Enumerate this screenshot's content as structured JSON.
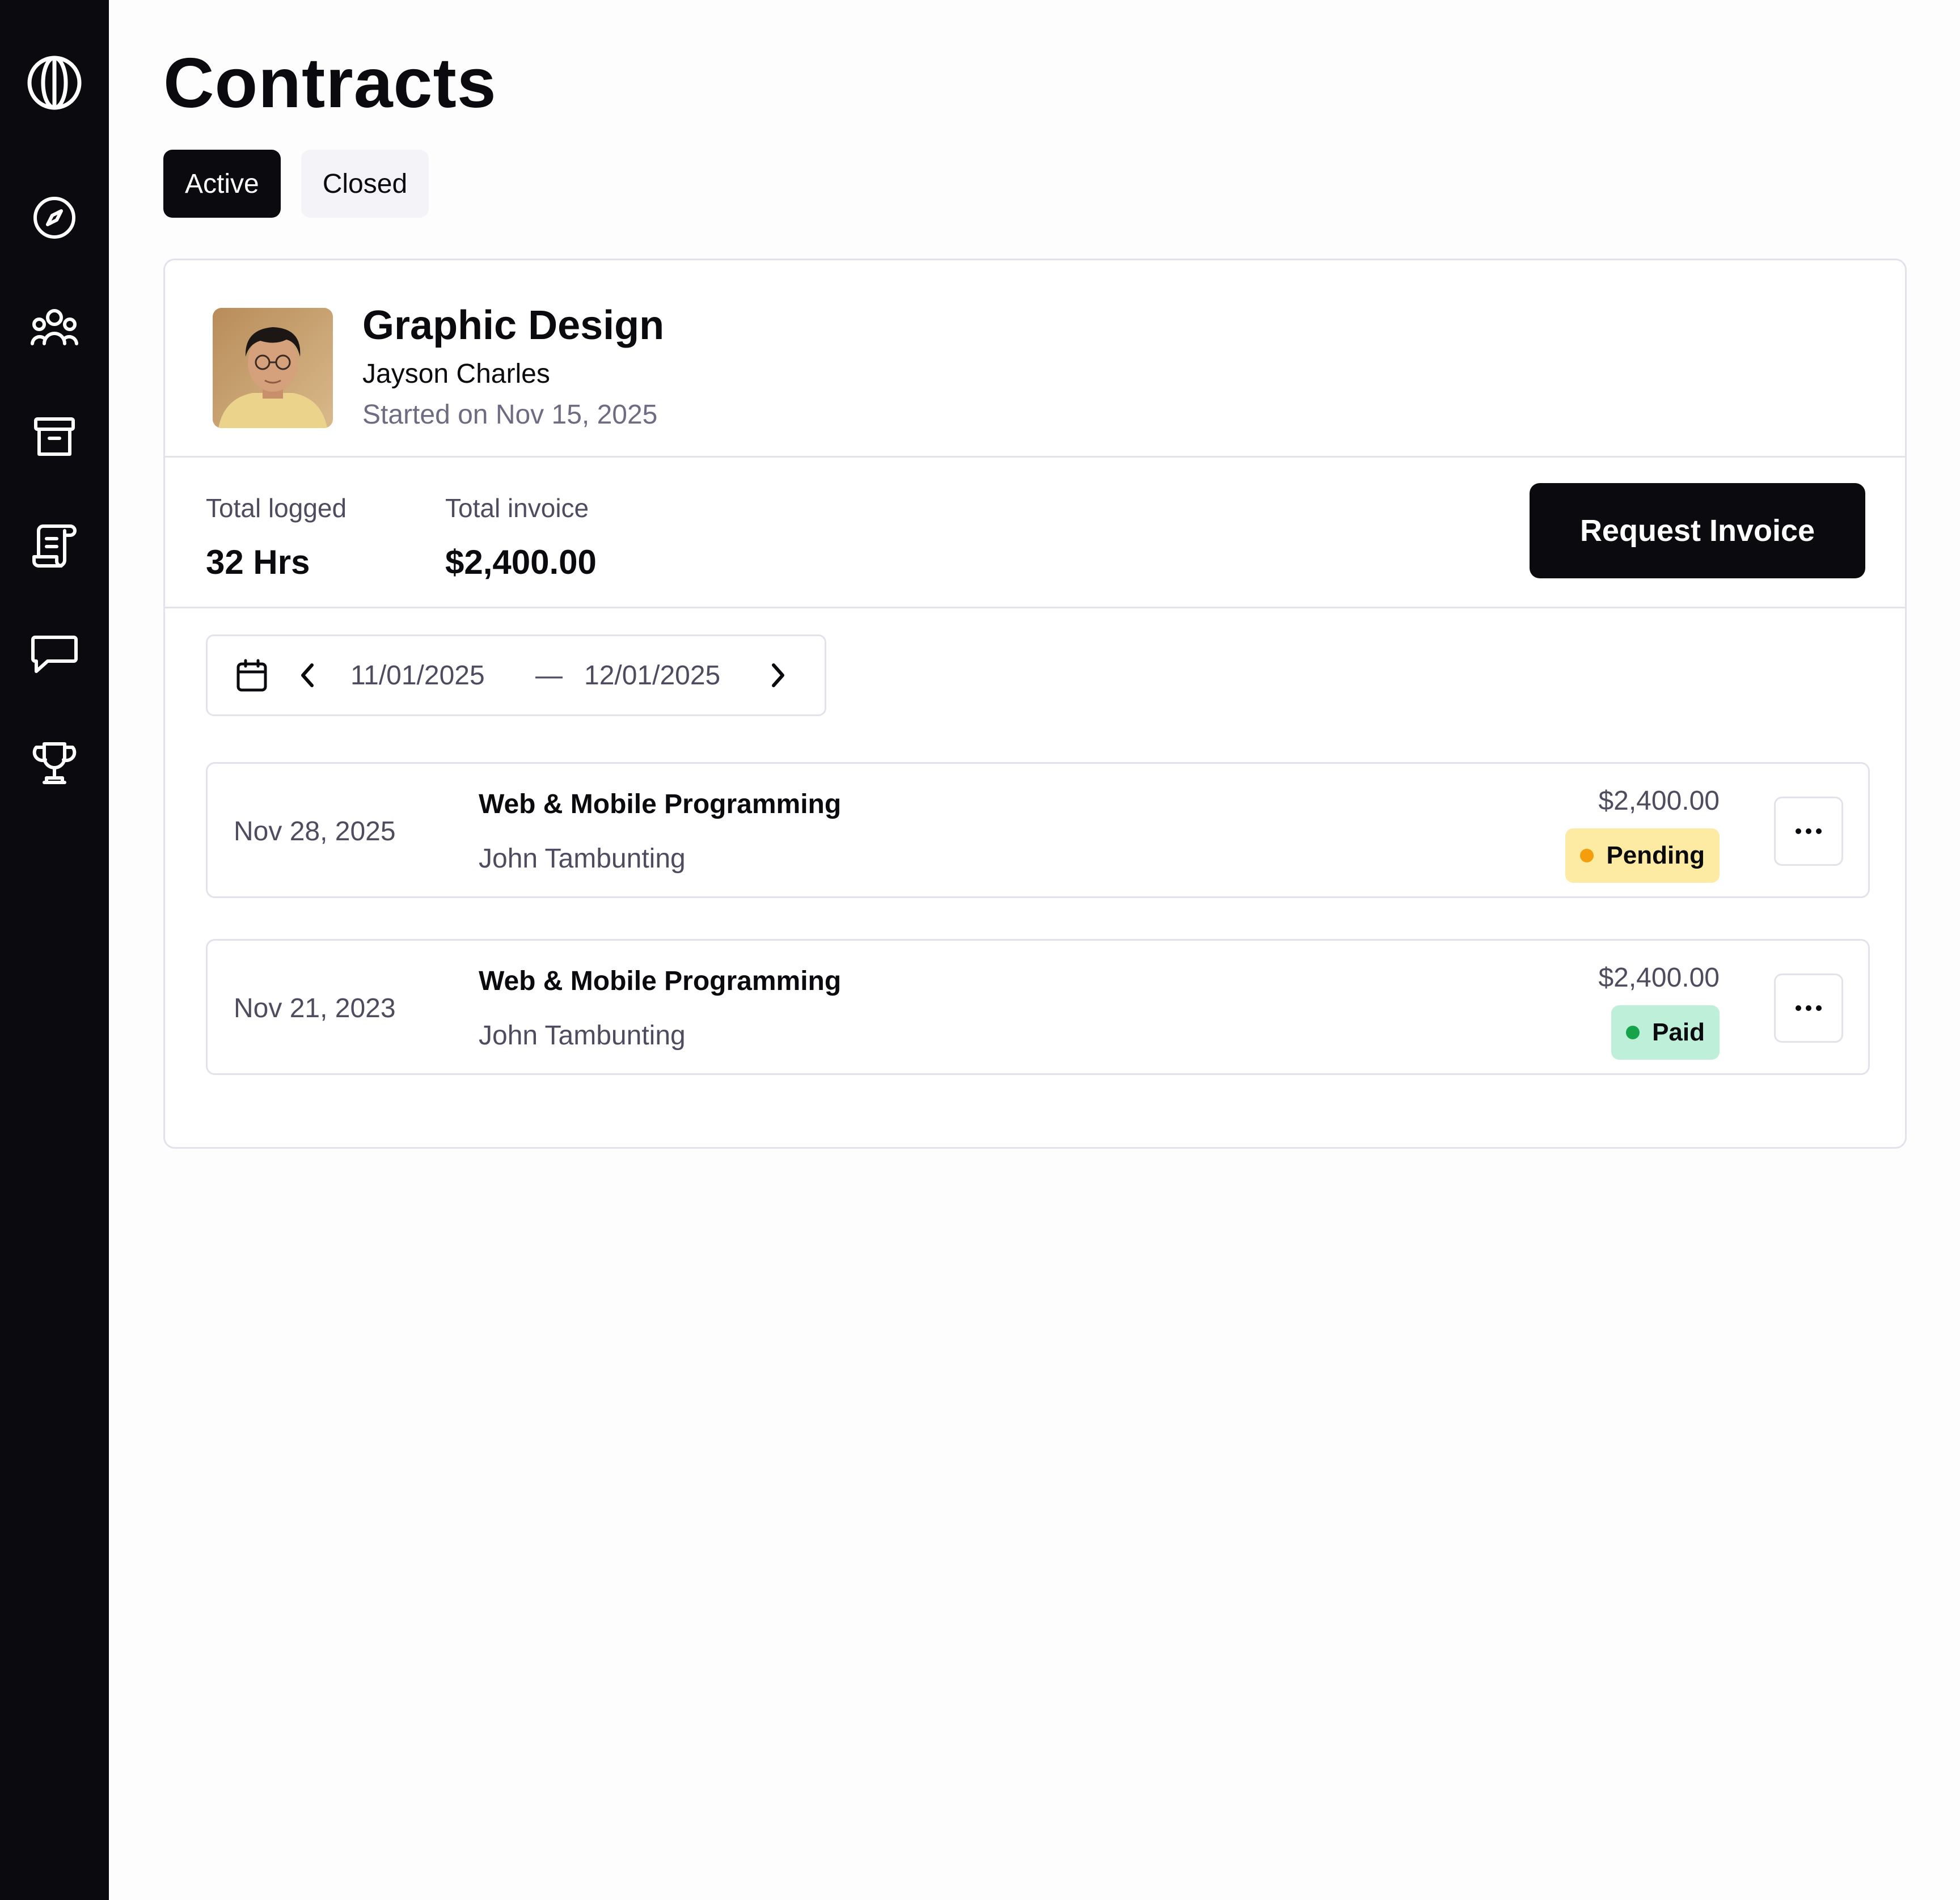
{
  "sidebar": {
    "icons": [
      "globe-logo-icon",
      "compass-icon",
      "users-icon",
      "archive-icon",
      "contract-document-icon",
      "message-icon",
      "trophy-icon"
    ]
  },
  "page": {
    "title": "Contracts"
  },
  "tabs": [
    {
      "label": "Active",
      "selected": true
    },
    {
      "label": "Closed",
      "selected": false
    }
  ],
  "contract": {
    "title": "Graphic Design",
    "client": "Jayson Charles",
    "started": "Started on Nov 15, 2025",
    "stats": {
      "logged_label": "Total logged",
      "logged_value": "32 Hrs",
      "invoice_label": "Total invoice",
      "invoice_value": "$2,400.00"
    },
    "request_button": "Request Invoice"
  },
  "date_range": {
    "start": "11/01/2025",
    "separator": "—",
    "end": "12/01/2025"
  },
  "entries": [
    {
      "date": "Nov 28, 2025",
      "title": "Web & Mobile Programming",
      "client": "John Tambunting",
      "amount": "$2,400.00",
      "status": "Pending"
    },
    {
      "date": "Nov 21, 2023",
      "title": "Web & Mobile Programming",
      "client": "John Tambunting",
      "amount": "$2,400.00",
      "status": "Paid"
    }
  ],
  "colors": {
    "sidebar": "#0B0A0E",
    "pending_bg": "#FDEBA3",
    "pending_dot": "#F59E0B",
    "paid_bg": "#BDEFD9",
    "paid_dot": "#16A34A",
    "border": "#E3E2EB"
  }
}
